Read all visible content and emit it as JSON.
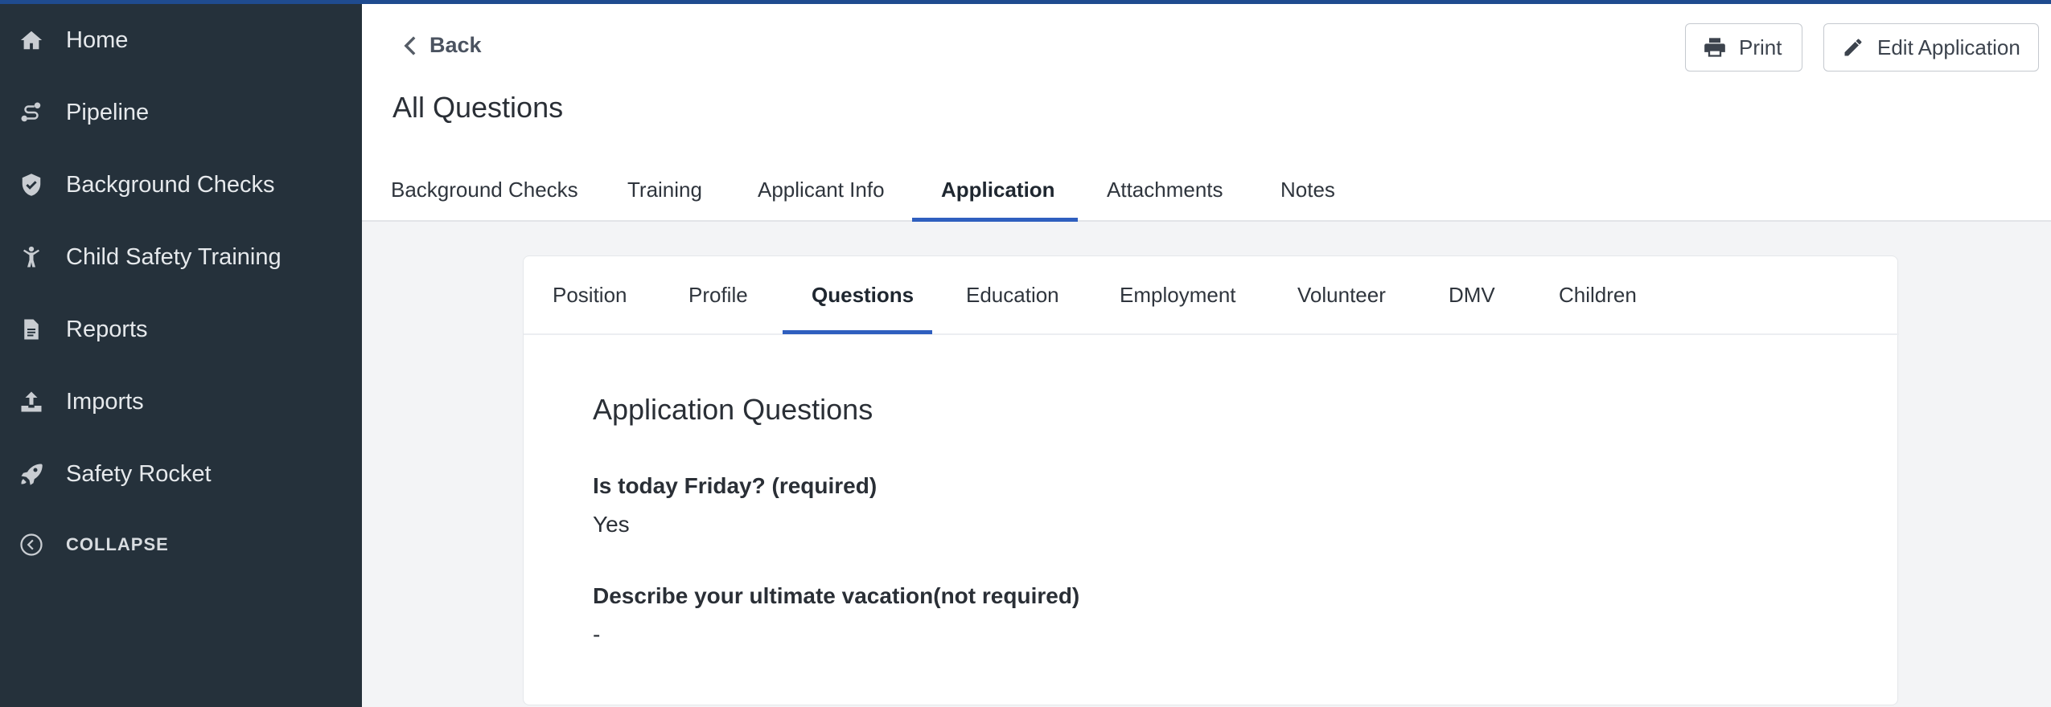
{
  "sidebar": {
    "items": [
      {
        "label": "Home",
        "icon": "home-icon"
      },
      {
        "label": "Pipeline",
        "icon": "route-icon"
      },
      {
        "label": "Background Checks",
        "icon": "shield-check-icon"
      },
      {
        "label": "Child Safety Training",
        "icon": "child-icon"
      },
      {
        "label": "Reports",
        "icon": "document-icon"
      },
      {
        "label": "Imports",
        "icon": "upload-icon"
      },
      {
        "label": "Safety Rocket",
        "icon": "rocket-icon"
      }
    ],
    "collapse_label": "COLLAPSE"
  },
  "header": {
    "back_label": "Back",
    "title": "All Questions",
    "print_label": "Print",
    "edit_label": "Edit Application",
    "tabs": [
      {
        "label": "Background Checks"
      },
      {
        "label": "Training"
      },
      {
        "label": "Applicant Info"
      },
      {
        "label": "Application",
        "active": true
      },
      {
        "label": "Attachments"
      },
      {
        "label": "Notes"
      }
    ]
  },
  "card": {
    "tabs": [
      {
        "label": "Position"
      },
      {
        "label": "Profile"
      },
      {
        "label": "Questions",
        "active": true
      },
      {
        "label": "Education"
      },
      {
        "label": "Employment"
      },
      {
        "label": "Volunteer"
      },
      {
        "label": "DMV"
      },
      {
        "label": "Children"
      }
    ],
    "section_title": "Application Questions",
    "questions": [
      {
        "question": "Is today Friday? (required)",
        "answer": "Yes"
      },
      {
        "question": "Describe your ultimate vacation(not required)",
        "answer": "-"
      }
    ]
  },
  "colors": {
    "sidebar_bg": "#25313b",
    "accent": "#2f5fbf",
    "top_bar": "#1f4b8f"
  }
}
